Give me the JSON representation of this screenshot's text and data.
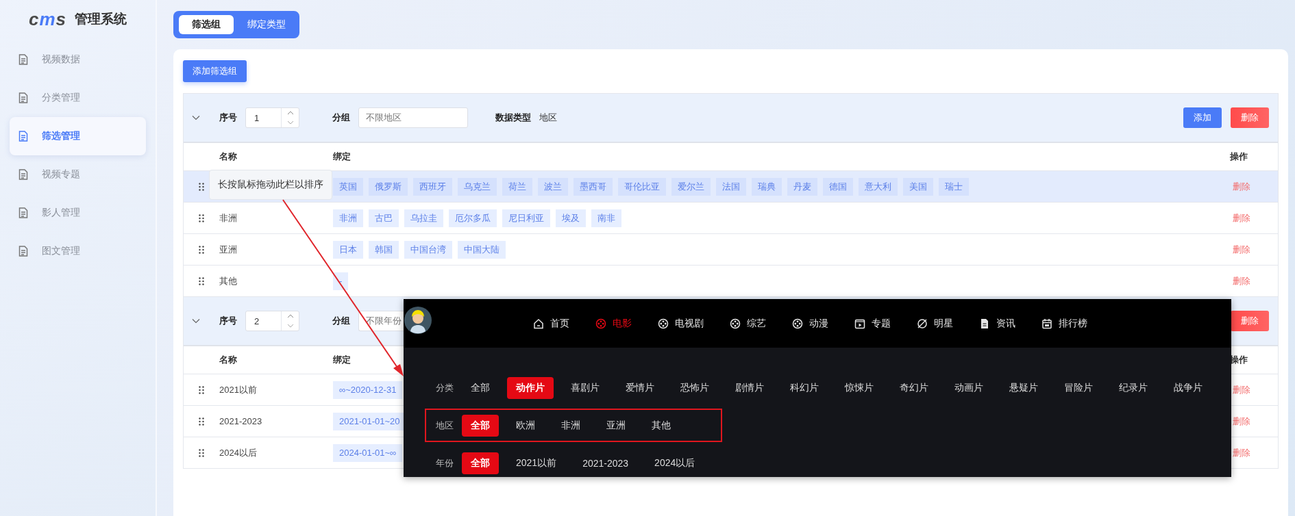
{
  "sidebar": {
    "logo": "cms",
    "title": "管理系统",
    "items": [
      {
        "label": "视频数据",
        "selected": false
      },
      {
        "label": "分类管理",
        "selected": false
      },
      {
        "label": "筛选管理",
        "selected": true
      },
      {
        "label": "视频专题",
        "selected": false
      },
      {
        "label": "影人管理",
        "selected": false
      },
      {
        "label": "图文管理",
        "selected": false
      }
    ]
  },
  "tabs": [
    {
      "label": "筛选组",
      "selected": true
    },
    {
      "label": "绑定类型",
      "selected": false
    }
  ],
  "add_group_button": "添加筛选组",
  "groups": [
    {
      "order_label": "序号",
      "order": "1",
      "group_label": "分组",
      "group_value": "不限地区",
      "type_label": "数据类型",
      "type_value": "地区",
      "add_button": "添加",
      "delete_button": "删除",
      "columns": [
        "名称",
        "绑定",
        "操作"
      ],
      "rows": [
        {
          "selected": true,
          "tags": [
            "英国",
            "俄罗斯",
            "西班牙",
            "乌克兰",
            "荷兰",
            "波兰",
            "墨西哥",
            "哥伦比亚",
            "爱尔兰",
            "法国",
            "瑞典",
            "丹麦",
            "德国",
            "意大利",
            "美国",
            "瑞士"
          ],
          "action": "删除"
        },
        {
          "selected": false,
          "name": "非洲",
          "tags": [
            "非洲",
            "古巴",
            "乌拉圭",
            "厄尔多瓜",
            "尼日利亚",
            "埃及",
            "南非"
          ],
          "action": "删除"
        },
        {
          "selected": false,
          "name": "亚洲",
          "tags": [
            "日本",
            "韩国",
            "中国台湾",
            "中国大陆"
          ],
          "action": "删除"
        },
        {
          "selected": false,
          "name": "其他",
          "tags": [
            "-"
          ],
          "action": "删除"
        }
      ]
    },
    {
      "order_label": "序号",
      "order": "2",
      "group_label": "分组",
      "group_value": "不限年份",
      "delete_button": "删除",
      "columns": [
        "名称",
        "绑定",
        "操作"
      ],
      "rows": [
        {
          "selected": false,
          "name": "2021以前",
          "tags": [
            "∞~2020-12-31"
          ],
          "action": "删除"
        },
        {
          "selected": false,
          "name": "2021-2023",
          "tags": [
            "2021-01-01~20"
          ],
          "action": "删除"
        },
        {
          "selected": false,
          "name": "2024以后",
          "tags": [
            "2024-01-01~∞"
          ],
          "action": "删除"
        }
      ]
    }
  ],
  "tooltip": "长按鼠标拖动此栏以排序",
  "preview": {
    "nav": [
      {
        "label": "首页",
        "selected": false
      },
      {
        "label": "电影",
        "selected": true
      },
      {
        "label": "电视剧",
        "selected": false
      },
      {
        "label": "综艺",
        "selected": false
      },
      {
        "label": "动漫",
        "selected": false
      },
      {
        "label": "专题",
        "selected": false
      },
      {
        "label": "明星",
        "selected": false
      },
      {
        "label": "资讯",
        "selected": false
      },
      {
        "label": "排行榜",
        "selected": false
      }
    ],
    "filters": [
      {
        "label": "分类",
        "outlined": false,
        "options": [
          {
            "label": "全部",
            "selected": false
          },
          {
            "label": "动作片",
            "selected": true
          },
          {
            "label": "喜剧片",
            "selected": false
          },
          {
            "label": "爱情片",
            "selected": false
          },
          {
            "label": "恐怖片",
            "selected": false
          },
          {
            "label": "剧情片",
            "selected": false
          },
          {
            "label": "科幻片",
            "selected": false
          },
          {
            "label": "惊悚片",
            "selected": false
          },
          {
            "label": "奇幻片",
            "selected": false
          },
          {
            "label": "动画片",
            "selected": false
          },
          {
            "label": "悬疑片",
            "selected": false
          },
          {
            "label": "冒险片",
            "selected": false
          },
          {
            "label": "纪录片",
            "selected": false
          },
          {
            "label": "战争片",
            "selected": false
          }
        ]
      },
      {
        "label": "地区",
        "outlined": true,
        "options": [
          {
            "label": "全部",
            "selected": true
          },
          {
            "label": "欧洲",
            "selected": false
          },
          {
            "label": "非洲",
            "selected": false
          },
          {
            "label": "亚洲",
            "selected": false
          },
          {
            "label": "其他",
            "selected": false
          }
        ]
      },
      {
        "label": "年份",
        "outlined": false,
        "options": [
          {
            "label": "全部",
            "selected": true
          },
          {
            "label": "2021以前",
            "selected": false
          },
          {
            "label": "2021-2023",
            "selected": false
          },
          {
            "label": "2024以后",
            "selected": false
          }
        ]
      }
    ]
  }
}
